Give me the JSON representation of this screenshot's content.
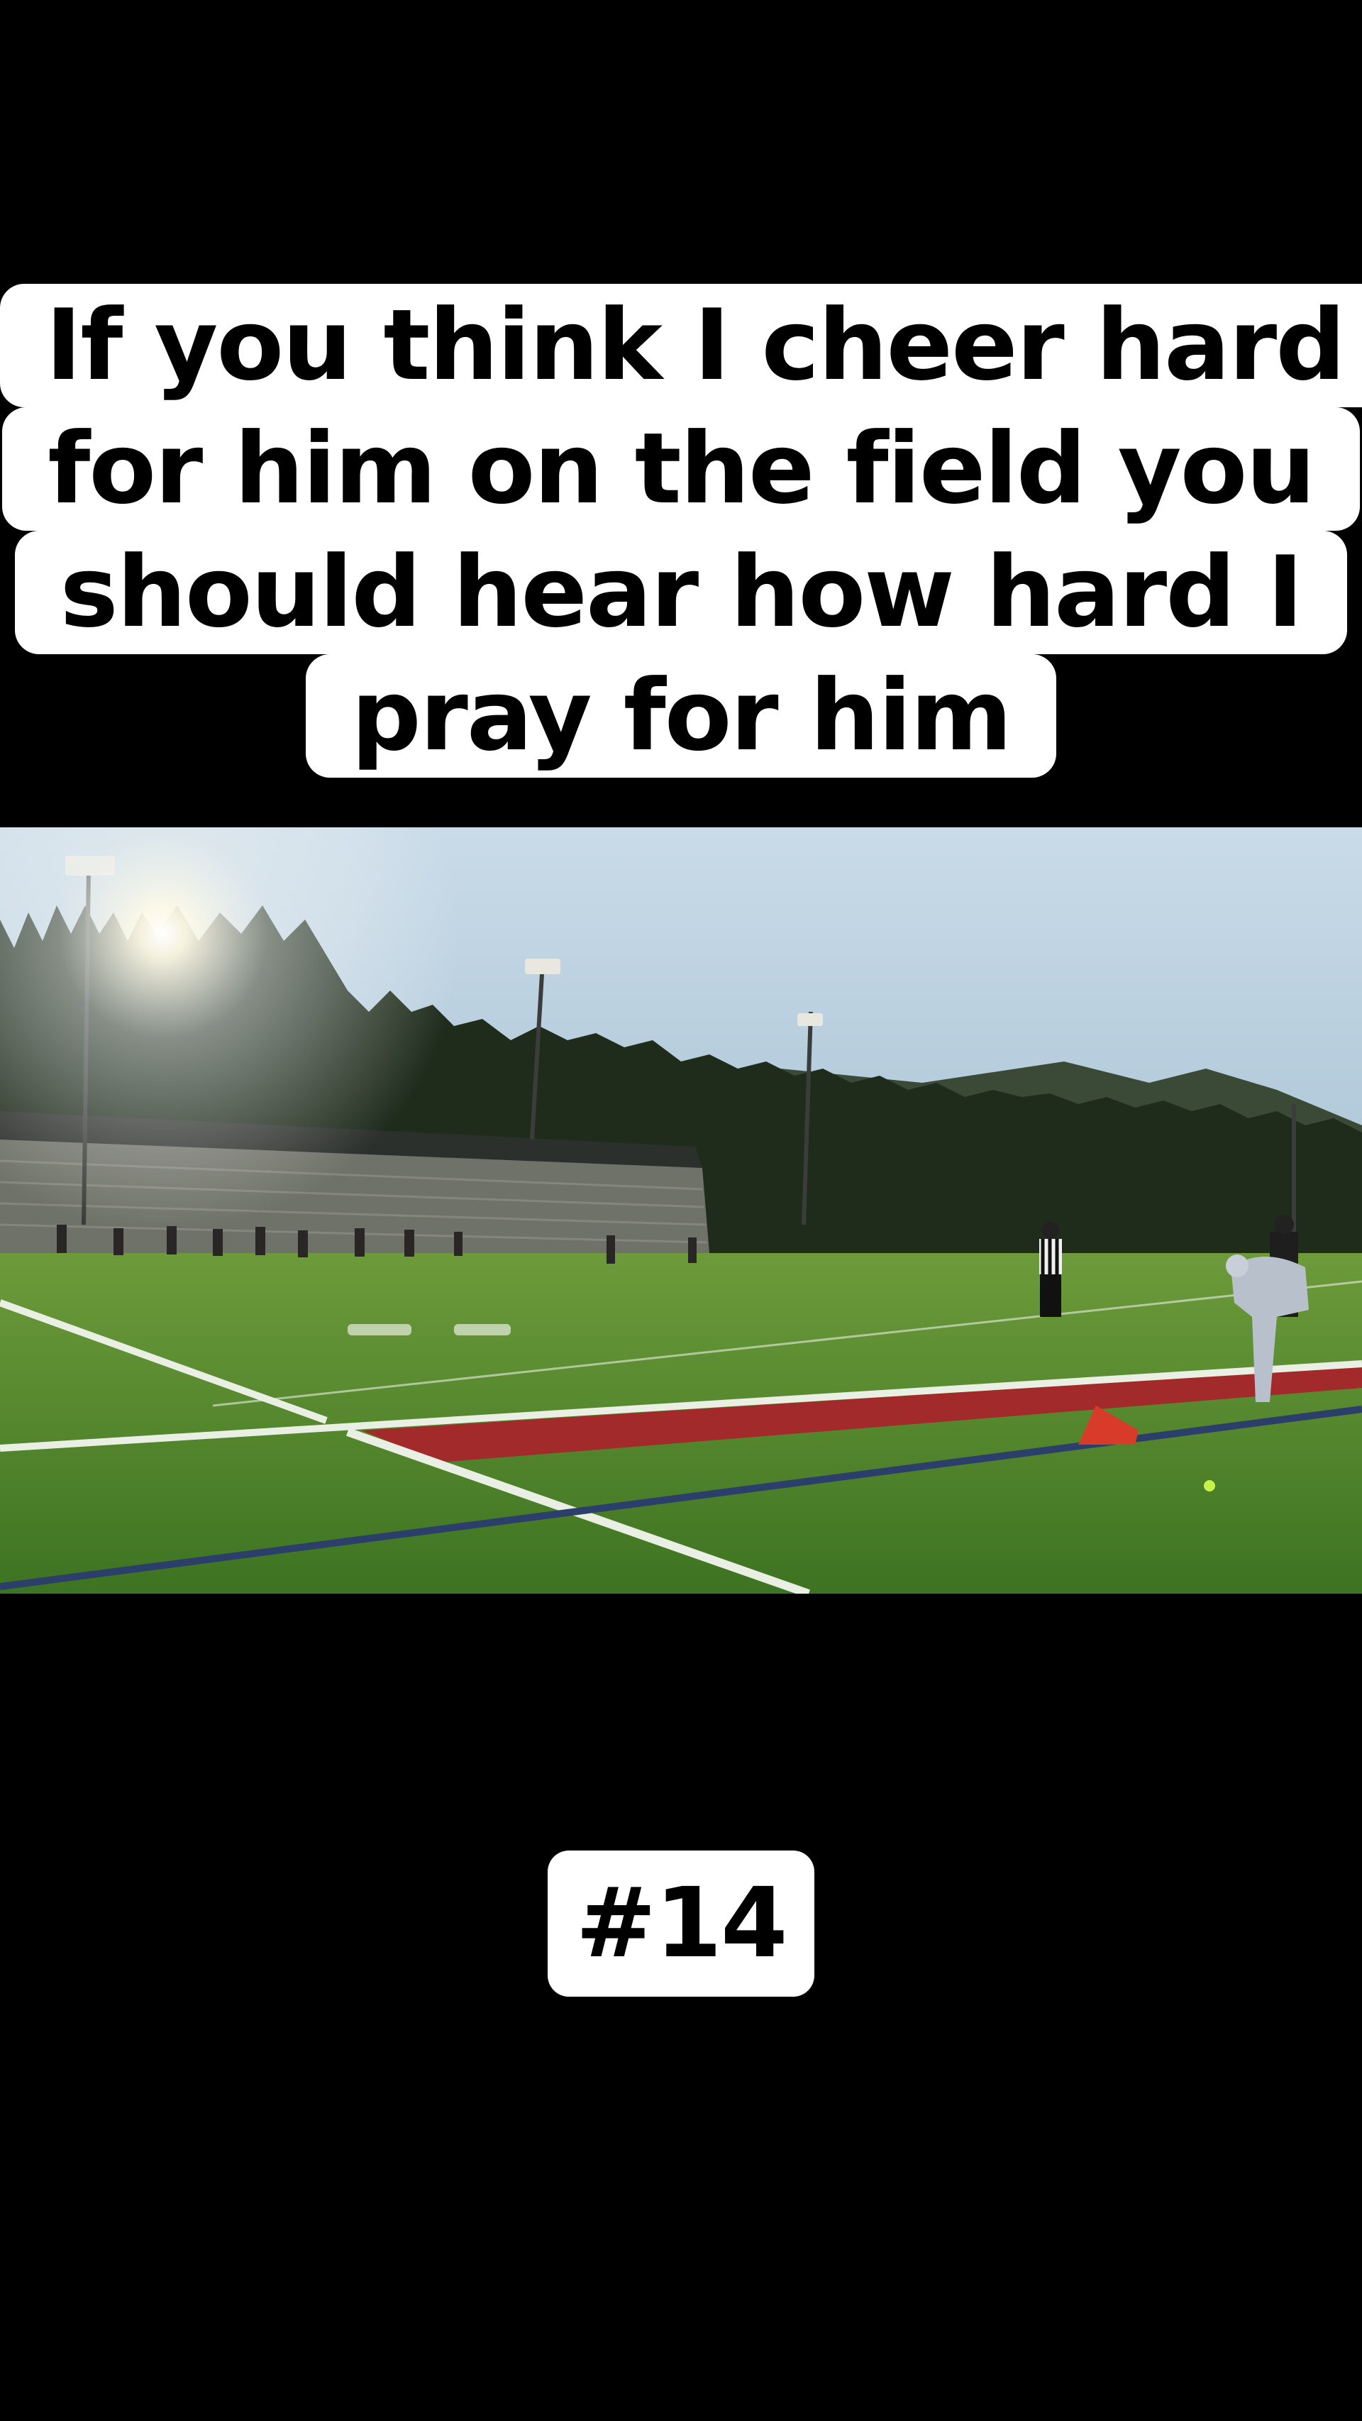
{
  "caption": {
    "lines": [
      "If you think I cheer hard",
      "for him on the field you",
      "should hear how hard I",
      "pray for him"
    ]
  },
  "tag": {
    "text": "#14"
  },
  "photo": {
    "subject": "football-field",
    "colors": {
      "sky": "#b9d3e4",
      "turf": "#4f8a2a",
      "endzone": "#a22a2a",
      "tree": "#1f2c1c"
    }
  }
}
